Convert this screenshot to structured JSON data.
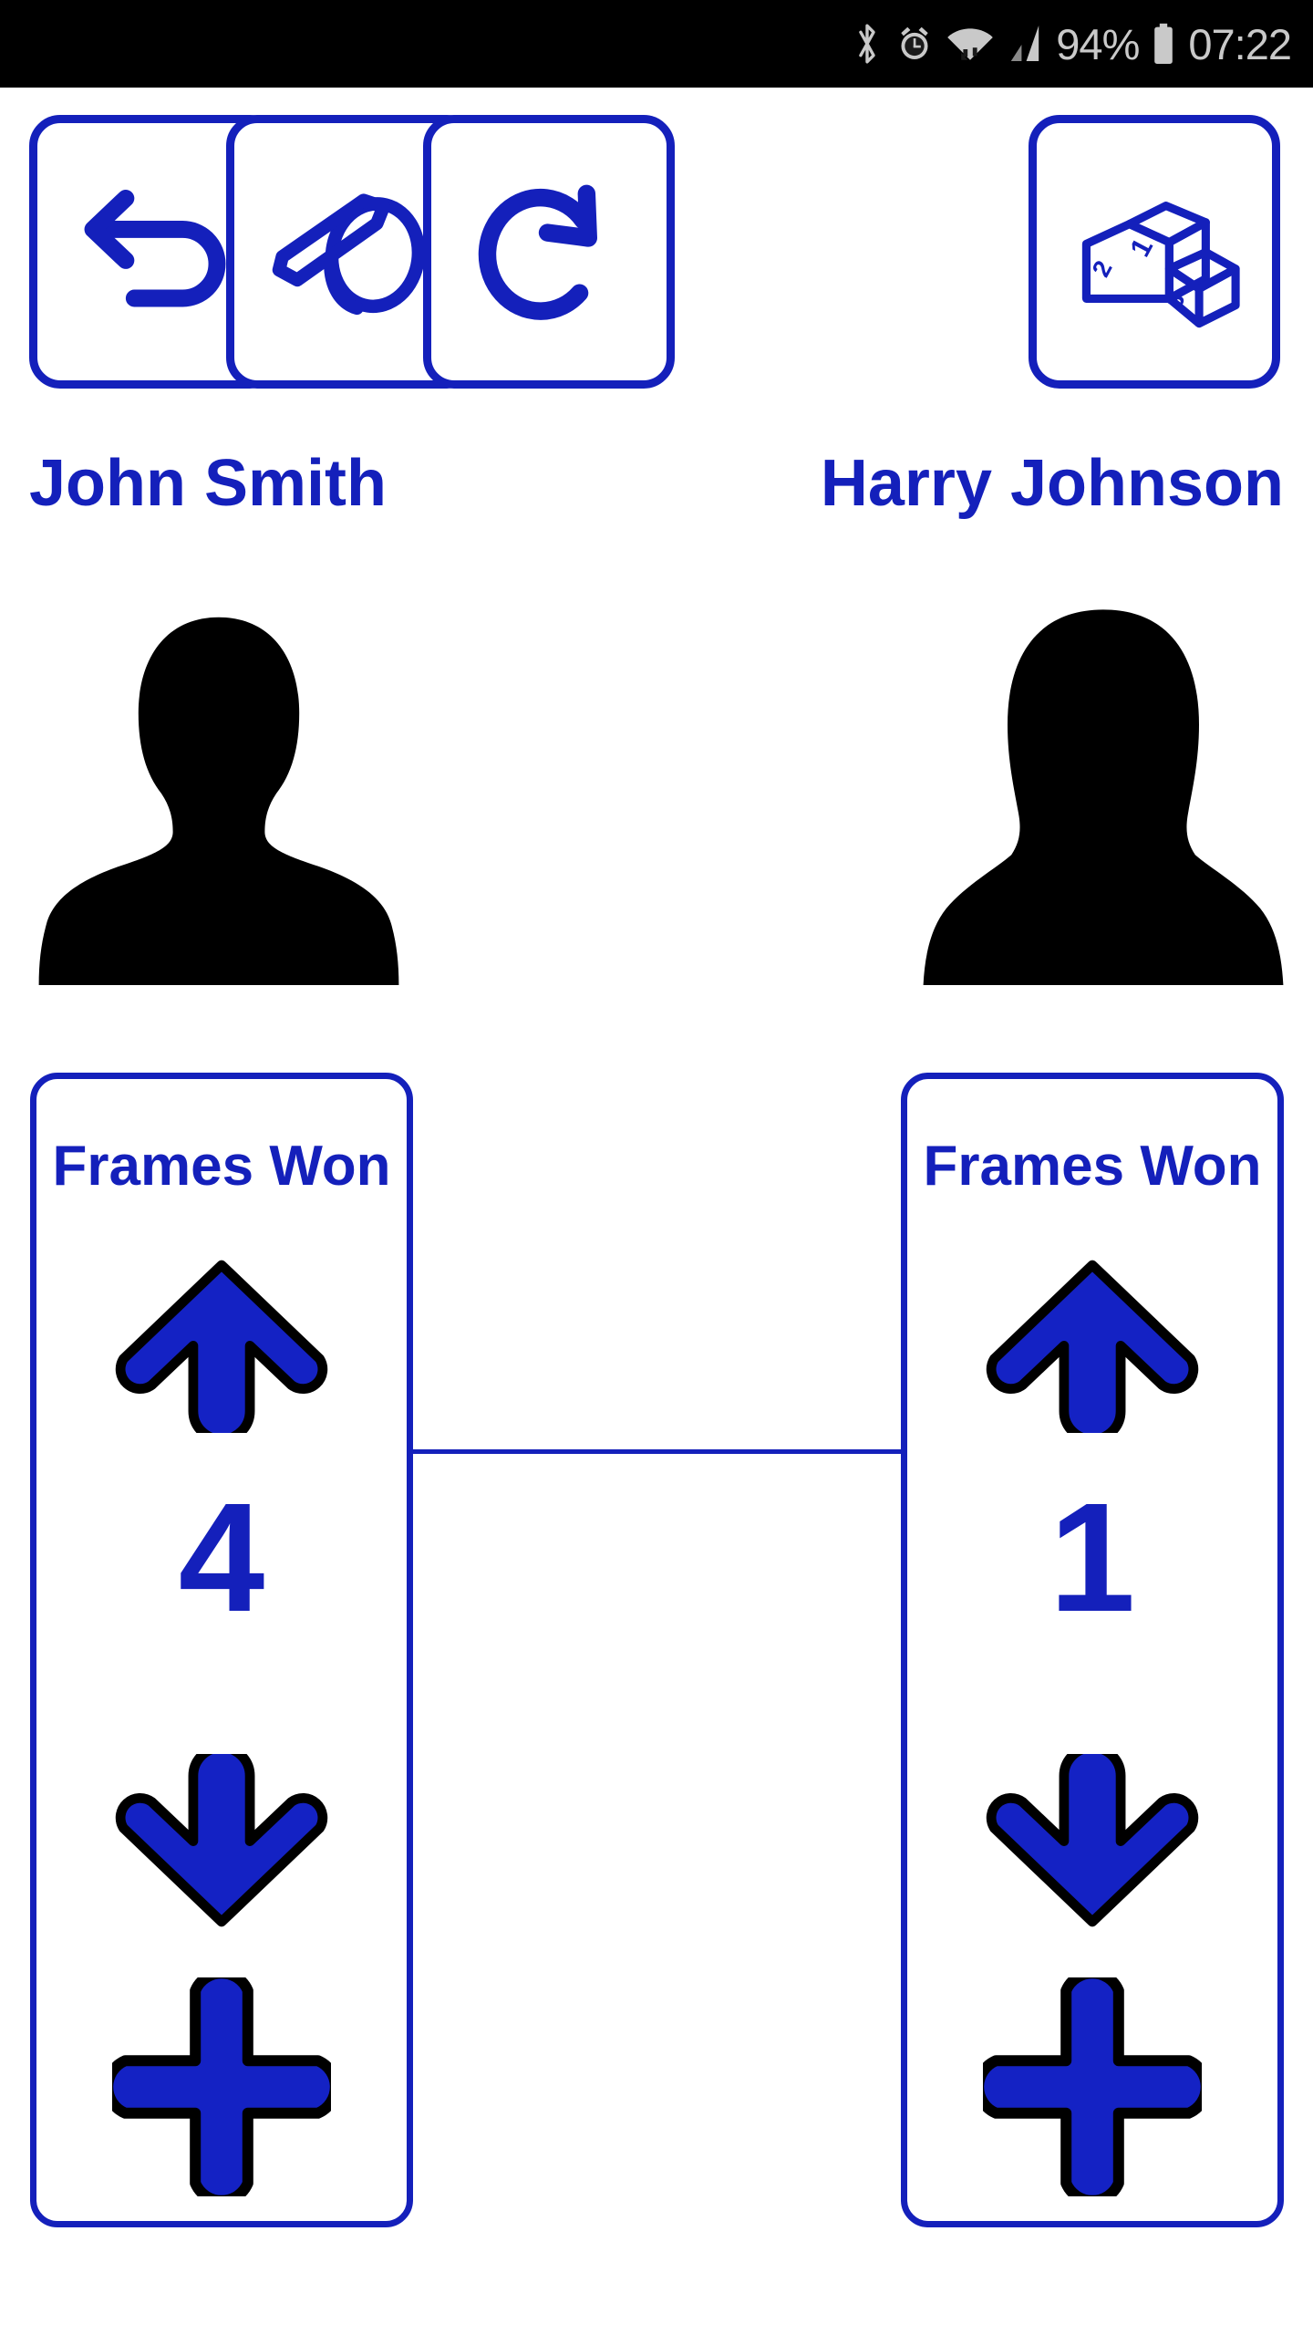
{
  "status_bar": {
    "icons": [
      "bluetooth-icon",
      "alarm-icon",
      "wifi-icon",
      "signal-icon",
      "battery-icon"
    ],
    "battery_percent": "94%",
    "time": "07:22"
  },
  "toolbar": {
    "buttons": [
      {
        "name": "undo-button",
        "icon": "undo-arrow-icon",
        "label": "Undo"
      },
      {
        "name": "whistle-button",
        "icon": "whistle-icon",
        "label": "Whistle"
      },
      {
        "name": "reset-button",
        "icon": "refresh-icon",
        "label": "Reset"
      },
      {
        "name": "leaderboard-button",
        "icon": "podium-icon",
        "label": "Leaderboard"
      }
    ]
  },
  "players": [
    {
      "name": "John Smith",
      "avatar": "male-silhouette-avatar",
      "panel": {
        "title": "Frames Won",
        "score": "4",
        "increment_label": "up-arrow",
        "decrement_label": "down-arrow",
        "add_label": "plus"
      }
    },
    {
      "name": "Harry Johnson",
      "avatar": "female-silhouette-avatar",
      "panel": {
        "title": "Frames Won",
        "score": "1",
        "increment_label": "up-arrow",
        "decrement_label": "down-arrow",
        "add_label": "plus"
      }
    }
  ],
  "colors": {
    "accent_blue": "#1420bb",
    "arrow_blue": "#1422c4",
    "arrow_outline": "#000000",
    "status_bar_bg": "#000000",
    "status_bar_fg": "#c9c9c9",
    "page_bg": "#ffffff",
    "avatar_fill": "#000000"
  }
}
